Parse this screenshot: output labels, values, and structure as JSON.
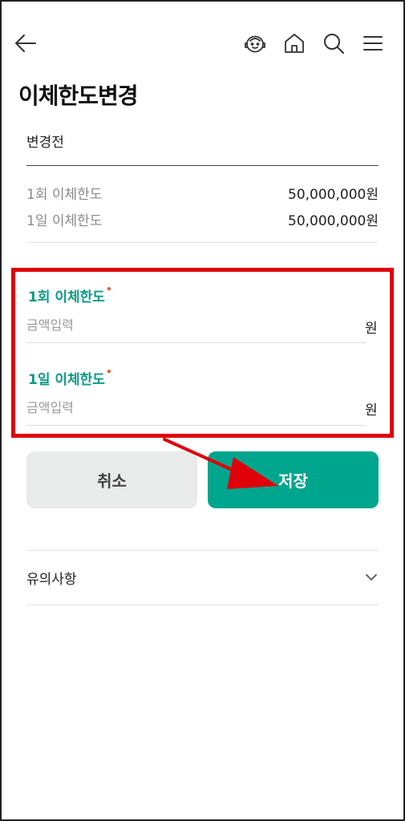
{
  "header": {
    "back_icon": "arrow-left-icon",
    "chat_icon": "chatbot-icon",
    "home_icon": "home-icon",
    "search_icon": "search-icon",
    "menu_icon": "menu-icon"
  },
  "page_title": "이체한도변경",
  "before": {
    "label": "변경전",
    "rows": [
      {
        "label": "1회 이체한도",
        "value": "50,000,000원"
      },
      {
        "label": "1일 이체한도",
        "value": "50,000,000원"
      }
    ]
  },
  "form": {
    "fields": [
      {
        "label": "1회 이체한도",
        "required_mark": "•",
        "placeholder": "금액입력",
        "unit": "원"
      },
      {
        "label": "1일 이체한도",
        "required_mark": "•",
        "placeholder": "금액입력",
        "unit": "원"
      }
    ]
  },
  "buttons": {
    "cancel": "취소",
    "save": "저장"
  },
  "notice": {
    "label": "유의사항",
    "icon": "chevron-down-icon"
  },
  "colors": {
    "accent": "#00a58d",
    "label_green": "#0b9a86",
    "highlight_red": "#e0000a",
    "required_dot": "#f05a2e"
  }
}
